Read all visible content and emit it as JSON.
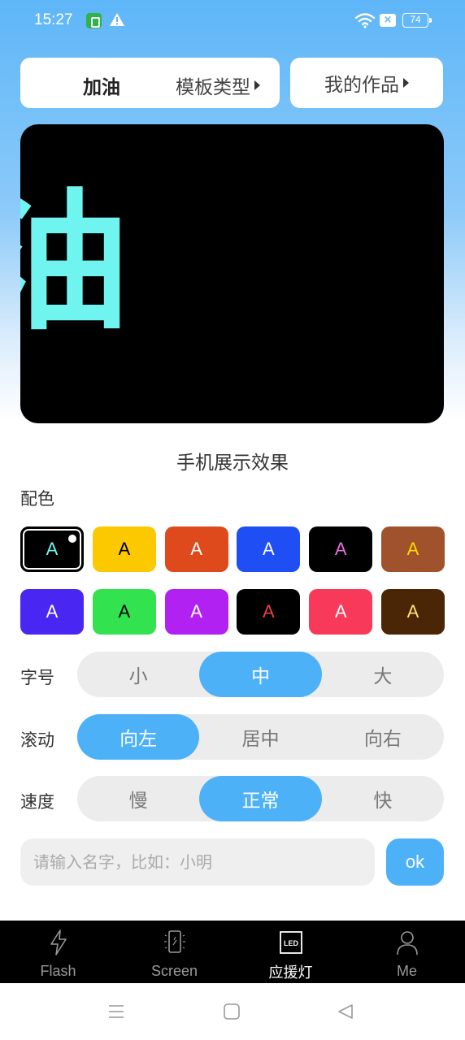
{
  "status_bar": {
    "time": "15:27",
    "battery": "74",
    "sim_mark": "×"
  },
  "header": {
    "template_name": "加油",
    "template_type_label": "模板类型",
    "my_works_label": "我的作品"
  },
  "preview": {
    "glyph": "油",
    "caption": "手机展示效果"
  },
  "color_section": {
    "label": "配色",
    "swatches": [
      {
        "letter": "A",
        "bg": "#000000",
        "fg": "#6ff4ef",
        "selected": true
      },
      {
        "letter": "A",
        "bg": "#fcc800",
        "fg": "#000000"
      },
      {
        "letter": "A",
        "bg": "#df4a1c",
        "fg": "#ffffff"
      },
      {
        "letter": "A",
        "bg": "#1f4ef5",
        "fg": "#ffffff"
      },
      {
        "letter": "A",
        "bg": "#000000",
        "fg": "#e86de0"
      },
      {
        "letter": "A",
        "bg": "#a0522d",
        "fg": "#fcd800"
      },
      {
        "letter": "A",
        "bg": "#4a26f2",
        "fg": "#ffffff"
      },
      {
        "letter": "A",
        "bg": "#32e24f",
        "fg": "#000000"
      },
      {
        "letter": "A",
        "bg": "#b122f2",
        "fg": "#ffffff"
      },
      {
        "letter": "A",
        "bg": "#000000",
        "fg": "#f04040"
      },
      {
        "letter": "A",
        "bg": "#f8395a",
        "fg": "#ffffff"
      },
      {
        "letter": "A",
        "bg": "#4a2506",
        "fg": "#ffe070"
      }
    ]
  },
  "font_size": {
    "label": "字号",
    "options": [
      "小",
      "中",
      "大"
    ],
    "selected": "中"
  },
  "scroll": {
    "label": "滚动",
    "options": [
      "向左",
      "居中",
      "向右"
    ],
    "selected": "向左"
  },
  "speed": {
    "label": "速度",
    "options": [
      "慢",
      "正常",
      "快"
    ],
    "selected": "正常"
  },
  "name_input": {
    "placeholder": "请输入名字，比如：小明",
    "value": ""
  },
  "ok_label": "ok",
  "bottom_nav": {
    "items": [
      {
        "label": "Flash",
        "icon": "lightning-icon"
      },
      {
        "label": "Screen",
        "icon": "phone-screen-icon"
      },
      {
        "label": "应援灯",
        "icon": "led-icon",
        "icon_text": "LED"
      },
      {
        "label": "Me",
        "icon": "person-icon"
      }
    ],
    "active": "应援灯"
  },
  "colors": {
    "accent": "#4db1f7",
    "preview_text": "#6ff4ef"
  }
}
